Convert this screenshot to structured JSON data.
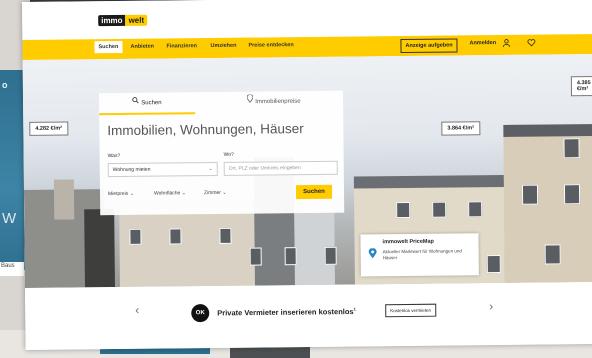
{
  "background": {
    "left_label": "o",
    "left_large_letter": "W",
    "left_field_text": "Baus",
    "bottom_button": "... ... ..."
  },
  "logo": {
    "part1": "immo",
    "part2": "welt"
  },
  "nav": {
    "items": [
      "Suchen",
      "Anbieten",
      "Finanzieren",
      "Umziehen",
      "Preise entdecken"
    ],
    "cta": "Anzeige aufgeben",
    "login": "Anmelden"
  },
  "hero": {
    "price_bubbles": [
      "4.282 €/m²",
      "3.864 €/m²",
      "4.385 €/m²"
    ]
  },
  "search": {
    "tab_active": "Suchen",
    "tab_other": "Immobilienpreise",
    "title": "Immobilien, Wohnungen, Häuser",
    "label_what": "Was?",
    "label_where": "Wo?",
    "what_value": "Wohnung mieten",
    "where_placeholder": "Ort, PLZ oder Umkreis eingeben",
    "filters": [
      "Mietpreis",
      "Wohnfläche",
      "Zimmer"
    ],
    "button": "Suchen"
  },
  "pricemap": {
    "title": "immowelt PriceMap",
    "subtitle": "Aktueller Marktwert für Wohnungen und Häuser"
  },
  "promo": {
    "badge": "OK",
    "text": "Private Vermieter inserieren kostenlos",
    "superscript": "1",
    "button": "Kostenlos vermieten"
  },
  "colors": {
    "brand_yellow": "#ffcc00",
    "text_dark": "#222222"
  }
}
